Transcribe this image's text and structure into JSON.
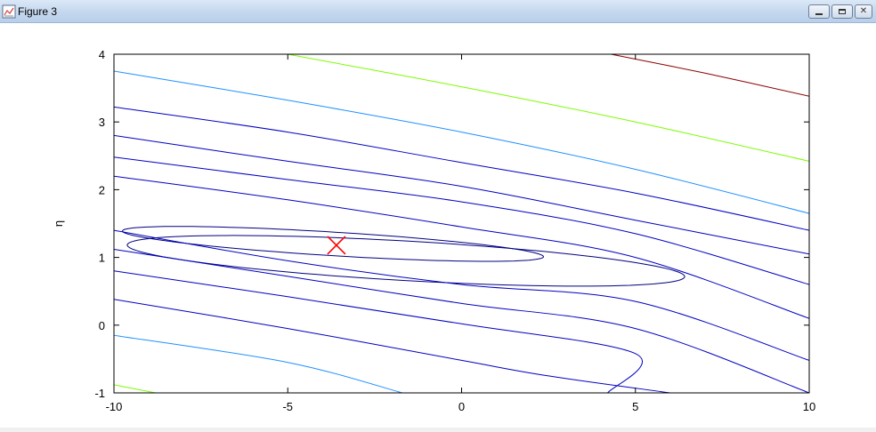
{
  "window": {
    "title": "Figure 3",
    "icons": [
      "figure-icon",
      "minimize-icon",
      "maximize-icon",
      "close-icon"
    ]
  },
  "chart_data": {
    "type": "contour",
    "title": "",
    "xlabel": "",
    "ylabel": "η",
    "xlim": [
      -10,
      10
    ],
    "ylim": [
      -1,
      4
    ],
    "xticks": [
      -10,
      -5,
      0,
      5,
      10
    ],
    "yticks": [
      -1,
      0,
      1,
      2,
      3,
      4
    ],
    "grid": false,
    "levels": [
      {
        "color": "#000080",
        "style": "closed",
        "center": [
          -3.7,
          1.2
        ],
        "semi_major": 6.3,
        "semi_minor": 0.18,
        "angle_deg": -16
      },
      {
        "color": "#000080",
        "style": "closed",
        "center": [
          -1.6,
          0.95
        ],
        "semi_major": 8.3,
        "semi_minor": 0.3,
        "angle_deg": -15
      },
      {
        "color": "#0000c0",
        "style": "open",
        "upper": [
          [
            -10,
            2.2
          ],
          [
            -5,
            1.85
          ],
          [
            0,
            1.45
          ],
          [
            5,
            1.0
          ],
          [
            10,
            0.1
          ]
        ],
        "lower": [
          [
            -10,
            1.4
          ],
          [
            -5,
            0.95
          ],
          [
            0,
            0.6
          ],
          [
            5,
            0.35
          ],
          [
            10,
            -0.52
          ]
        ]
      },
      {
        "color": "#0000c0",
        "style": "open",
        "upper": [
          [
            -10,
            2.48
          ],
          [
            -5,
            2.15
          ],
          [
            0,
            1.82
          ],
          [
            5,
            1.35
          ],
          [
            10,
            0.6
          ]
        ],
        "lower": [
          [
            -10,
            1.12
          ],
          [
            -5,
            0.72
          ],
          [
            0,
            0.32
          ],
          [
            5,
            -0.05
          ],
          [
            10,
            -1.0
          ]
        ]
      },
      {
        "color": "#0000c0",
        "style": "open",
        "upper": [
          [
            -10,
            2.8
          ],
          [
            -5,
            2.42
          ],
          [
            0,
            2.05
          ],
          [
            5,
            1.55
          ],
          [
            10,
            1.05
          ]
        ],
        "lower": [
          [
            -10,
            0.8
          ],
          [
            -5,
            0.42
          ],
          [
            0,
            0.02
          ],
          [
            5,
            -0.42
          ],
          [
            4.2,
            -1.0
          ]
        ]
      },
      {
        "color": "#0000c0",
        "style": "open",
        "upper": [
          [
            -10,
            3.22
          ],
          [
            -5,
            2.85
          ],
          [
            0,
            2.4
          ],
          [
            5,
            1.95
          ],
          [
            10,
            1.4
          ]
        ],
        "lower": [
          [
            -10,
            0.38
          ],
          [
            -5,
            -0.05
          ],
          [
            0,
            -0.52
          ],
          [
            2.5,
            -0.75
          ],
          [
            6,
            -1.0
          ]
        ]
      },
      {
        "color": "#1e90ff",
        "style": "open",
        "upper": [
          [
            -10,
            3.75
          ],
          [
            -5,
            3.32
          ],
          [
            0,
            2.85
          ],
          [
            5,
            2.3
          ],
          [
            10,
            1.65
          ]
        ],
        "lower": [
          [
            -10,
            -0.15
          ],
          [
            -5,
            -0.55
          ],
          [
            -1.7,
            -1.0
          ]
        ]
      },
      {
        "color": "#7cfc00",
        "style": "open",
        "upper": [
          [
            -5,
            4.0
          ],
          [
            0,
            3.52
          ],
          [
            5,
            3.0
          ],
          [
            10,
            2.42
          ]
        ],
        "lower": [
          [
            -10,
            -0.88
          ],
          [
            -8.8,
            -1.0
          ]
        ]
      },
      {
        "color": "#8b0000",
        "style": "open",
        "upper": [
          [
            4.3,
            4.0
          ],
          [
            7,
            3.72
          ],
          [
            10,
            3.38
          ]
        ],
        "lower": []
      }
    ],
    "markers": [
      {
        "symbol": "x",
        "color": "#ff0000",
        "x": -3.6,
        "y": 1.18
      }
    ]
  }
}
